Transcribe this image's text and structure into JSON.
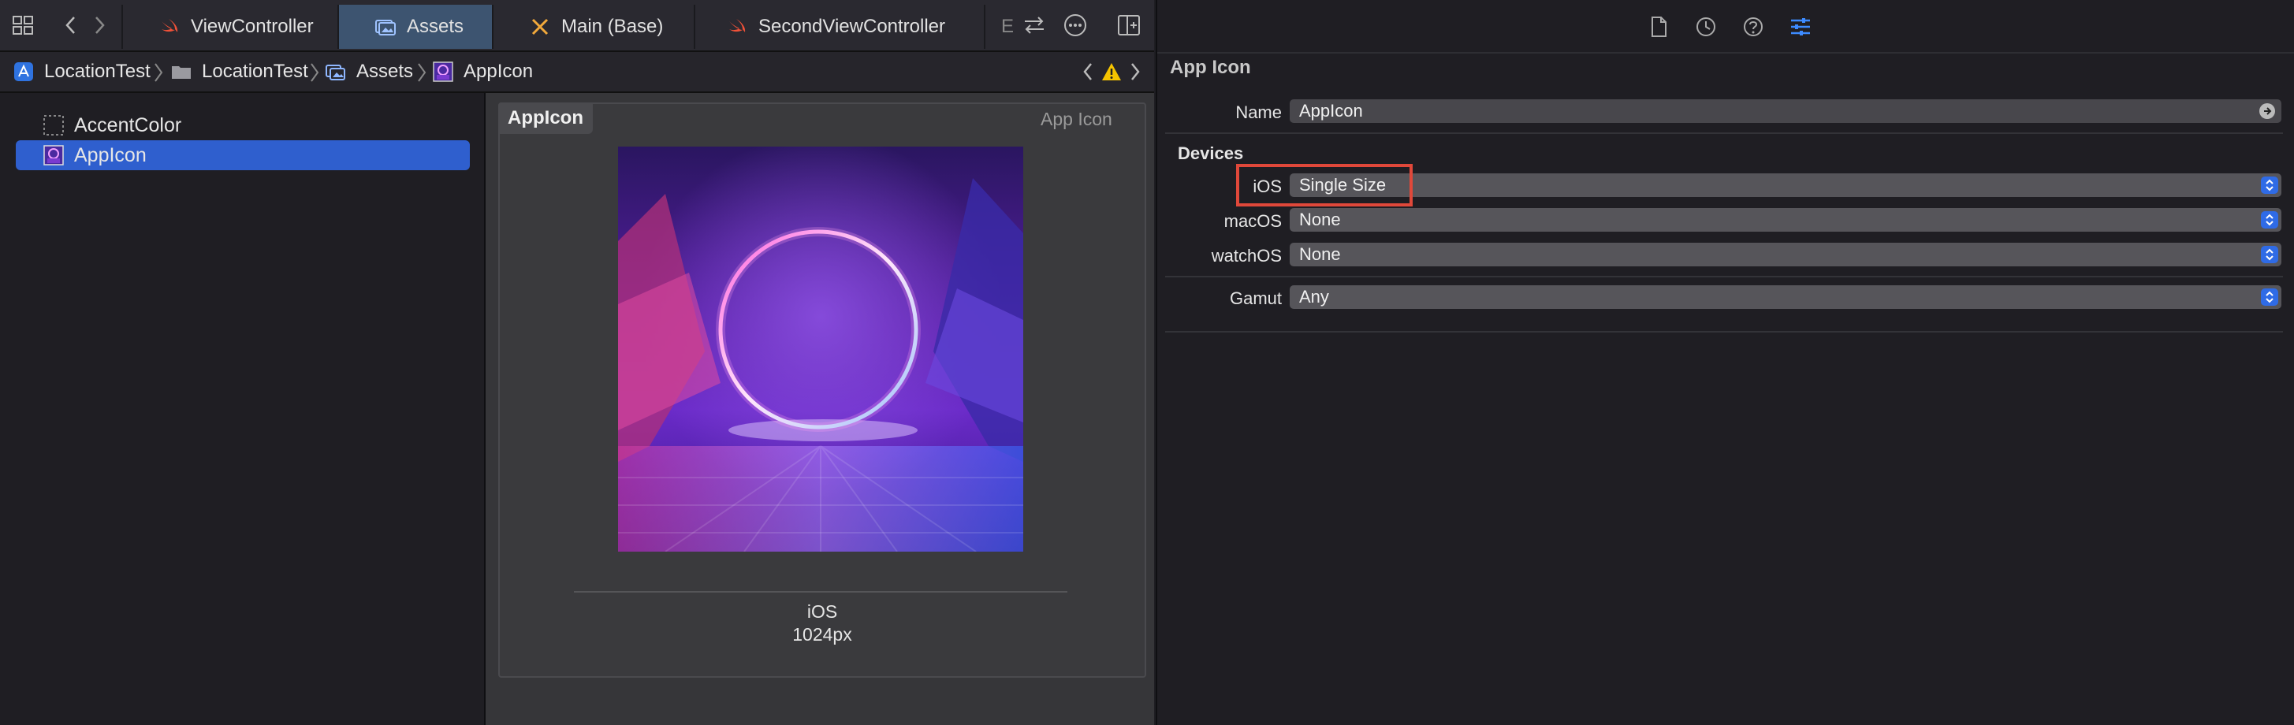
{
  "tabs": [
    {
      "label": "ViewController",
      "icon": "swift-icon",
      "active": false
    },
    {
      "label": "Assets",
      "icon": "asset-catalog-icon",
      "active": true
    },
    {
      "label": "Main (Base)",
      "icon": "storyboard-icon",
      "active": false
    },
    {
      "label": "SecondViewController",
      "icon": "swift-icon",
      "active": false
    },
    {
      "label": "E",
      "icon": "",
      "active": false
    }
  ],
  "breadcrumbs": [
    {
      "label": "LocationTest",
      "icon": "project-icon"
    },
    {
      "label": "LocationTest",
      "icon": "folder-icon"
    },
    {
      "label": "Assets",
      "icon": "asset-catalog-icon"
    },
    {
      "label": "AppIcon",
      "icon": "app-icon-thumb"
    }
  ],
  "navigator": {
    "items": [
      {
        "label": "AccentColor",
        "icon": "color-set-icon",
        "selected": false
      },
      {
        "label": "AppIcon",
        "icon": "app-icon-thumb",
        "selected": true
      }
    ]
  },
  "canvas": {
    "set_title": "AppIcon",
    "set_kind": "App Icon",
    "slot_platform": "iOS",
    "slot_size": "1024px"
  },
  "inspector": {
    "title": "App Icon",
    "name_label": "Name",
    "name_value": "AppIcon",
    "devices_header": "Devices",
    "ios_label": "iOS",
    "ios_value": "Single Size",
    "macos_label": "macOS",
    "macos_value": "None",
    "watchos_label": "watchOS",
    "watchos_value": "None",
    "gamut_label": "Gamut",
    "gamut_value": "Any"
  },
  "colors": {
    "accent": "#2f5fce",
    "active_tab": "#3d5470",
    "highlight": "#e0483a",
    "warning": "#f5c400"
  }
}
